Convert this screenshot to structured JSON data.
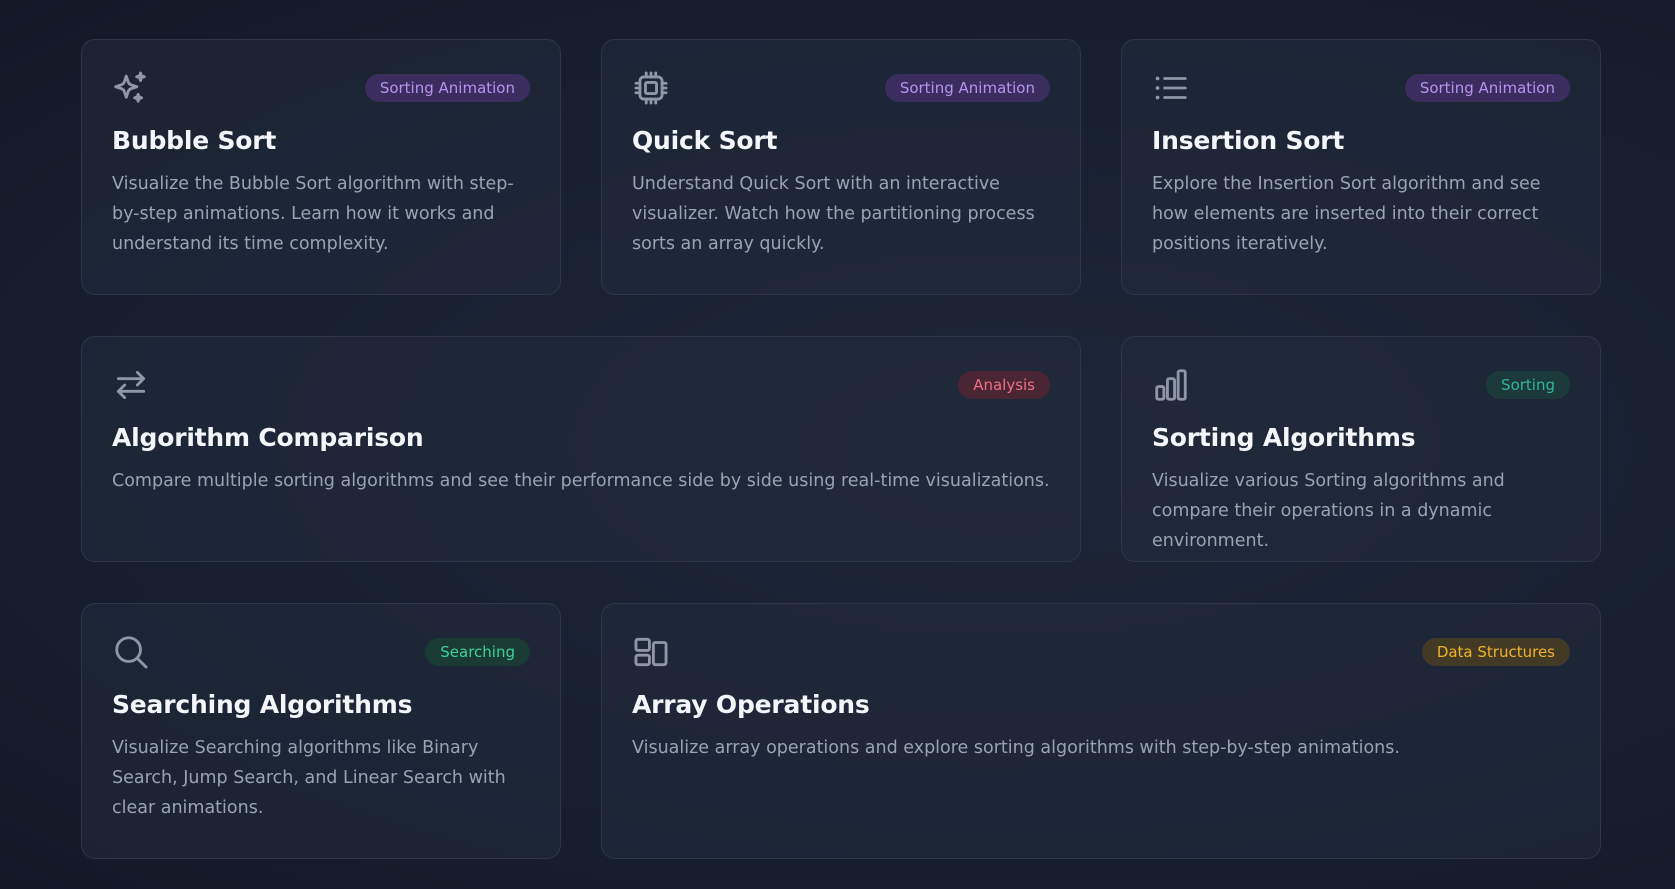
{
  "cards": [
    {
      "icon": "sparkles-icon",
      "badge": "Sorting Animation",
      "badge_color": "#b794f0",
      "title": "Bubble Sort",
      "description": "Visualize the Bubble Sort algorithm with step-by-step animations. Learn how it works and understand its time complexity."
    },
    {
      "icon": "cpu-chip-icon",
      "badge": "Sorting Animation",
      "badge_color": "#b794f0",
      "title": "Quick Sort",
      "description": "Understand Quick Sort with an interactive visualizer. Watch how the partitioning process sorts an array quickly."
    },
    {
      "icon": "list-icon",
      "badge": "Sorting Animation",
      "badge_color": "#b794f0",
      "title": "Insertion Sort",
      "description": "Explore the Insertion Sort algorithm and see how elements are inserted into their correct positions iteratively."
    },
    {
      "icon": "arrows-swap-icon",
      "badge": "Analysis",
      "badge_color": "#f07088",
      "title": "Algorithm Comparison",
      "description": "Compare multiple sorting algorithms and see their performance side by side using real-time visualizations."
    },
    {
      "icon": "bar-chart-icon",
      "badge": "Sorting",
      "badge_color": "#2fb59a",
      "title": "Sorting Algorithms",
      "description": "Visualize various Sorting algorithms and compare their operations in a dynamic environment."
    },
    {
      "icon": "search-icon",
      "badge": "Searching",
      "badge_color": "#3fd29b",
      "title": "Searching Algorithms",
      "description": "Visualize Searching algorithms like Binary Search, Jump Search, and Linear Search with clear animations."
    },
    {
      "icon": "layout-blocks-icon",
      "badge": "Data Structures",
      "badge_color": "#f0b429",
      "title": "Array Operations",
      "description": "Visualize array operations and explore sorting algorithms with step-by-step animations."
    }
  ]
}
